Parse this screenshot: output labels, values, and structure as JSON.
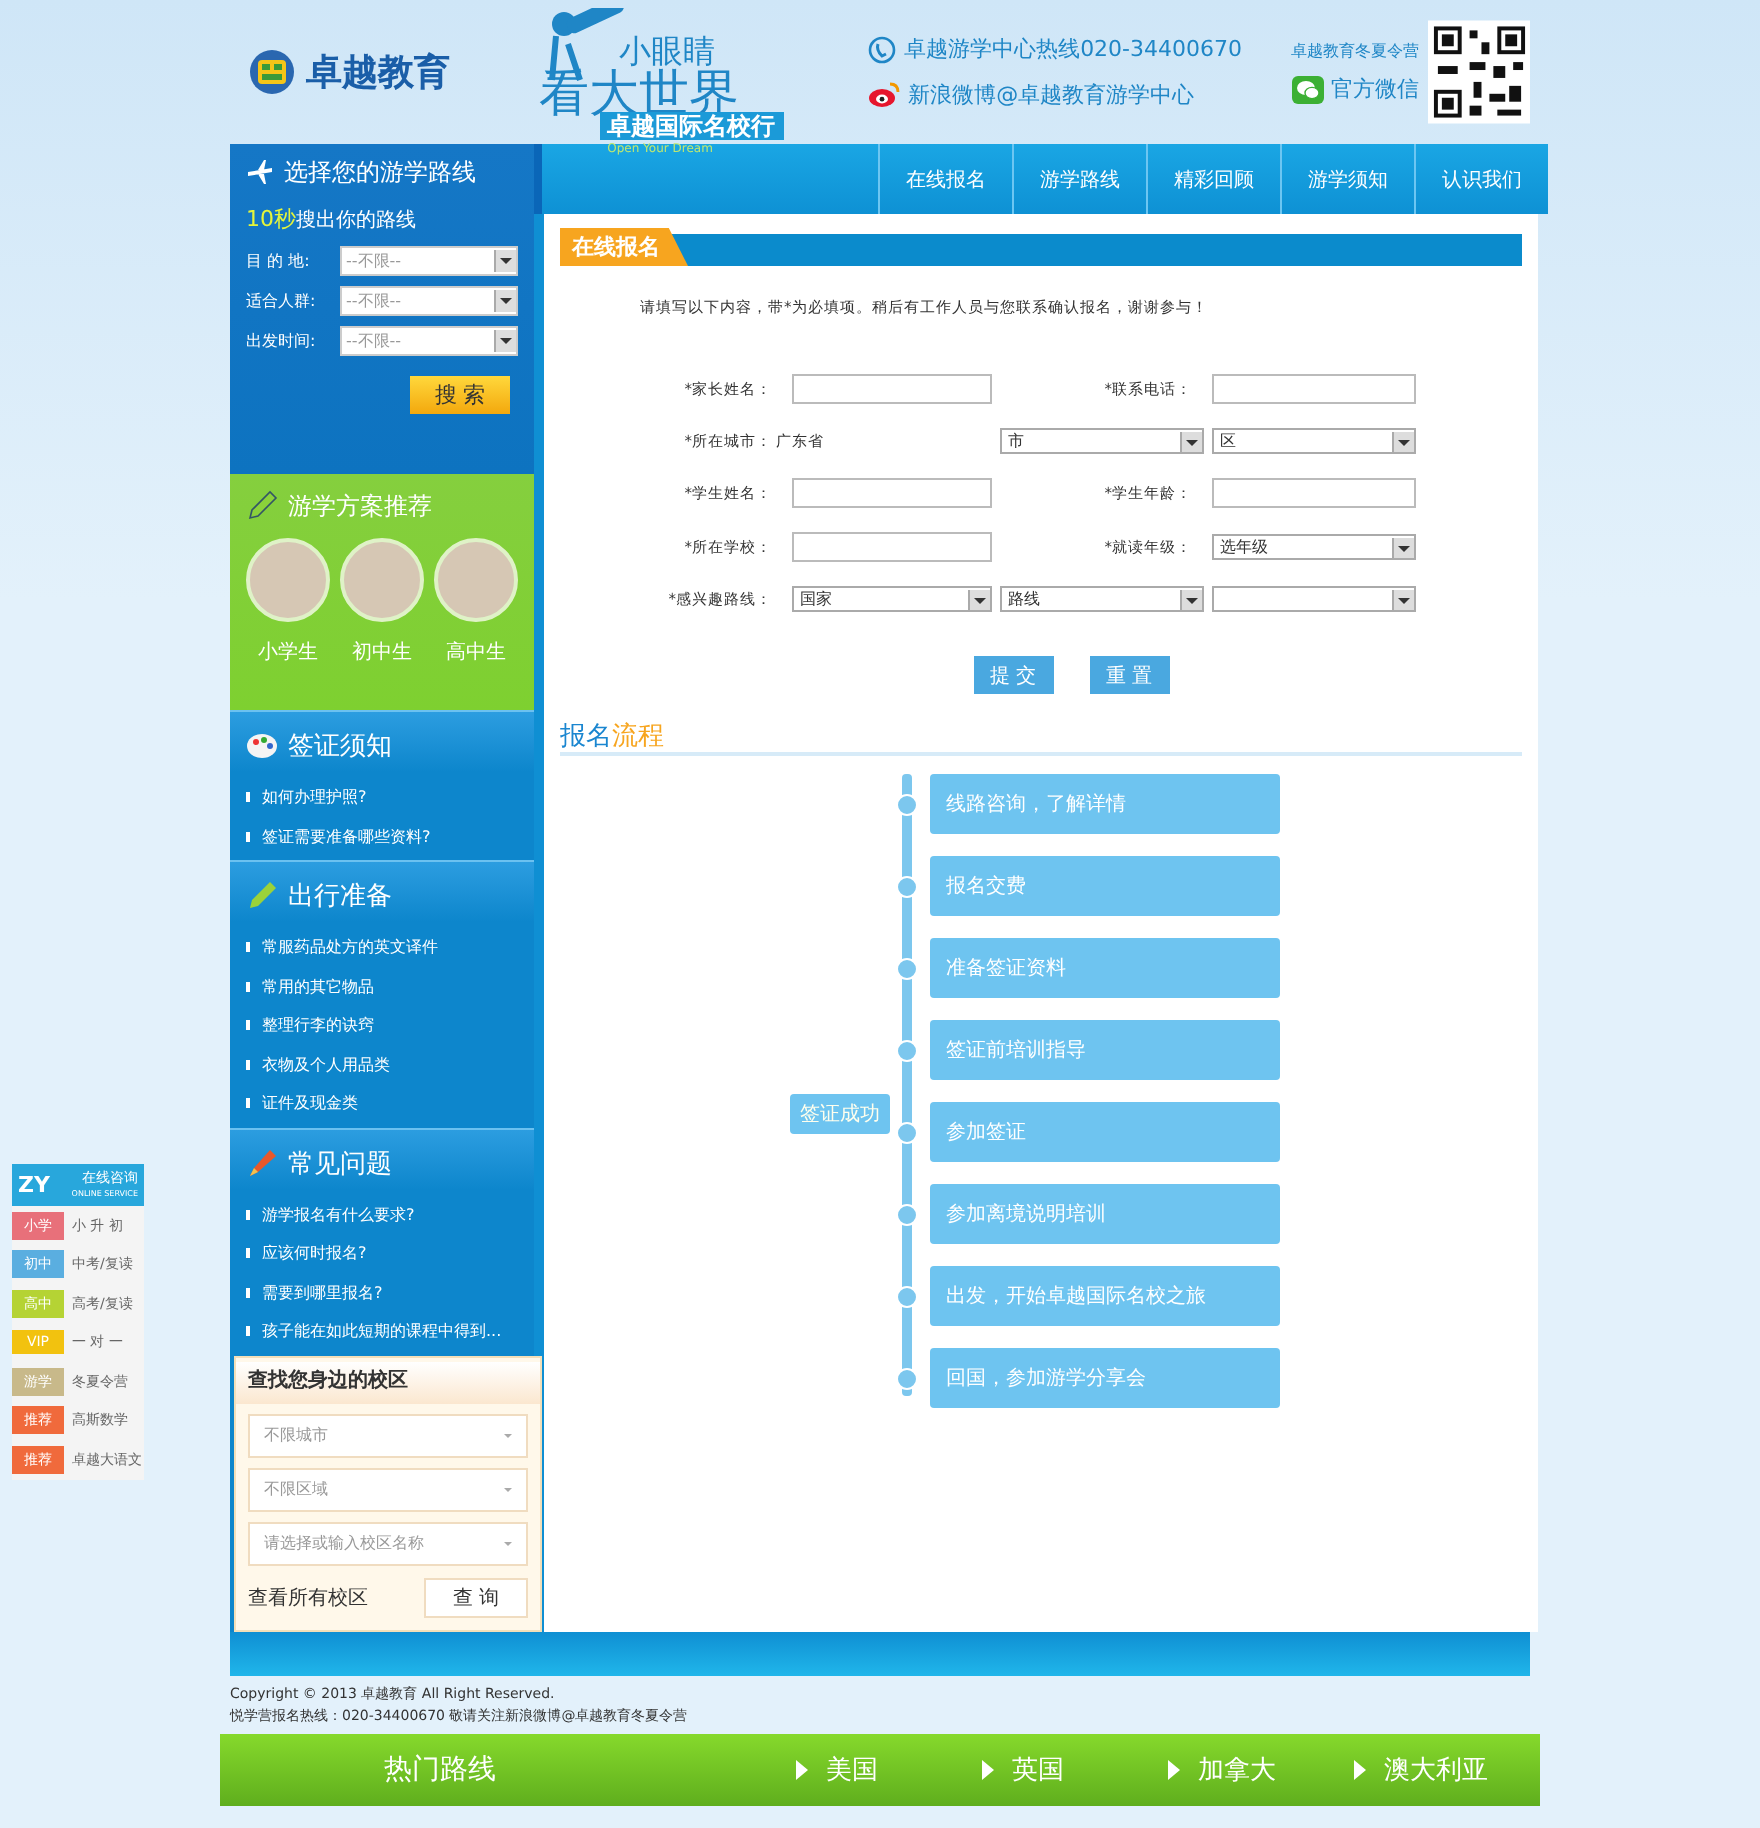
{
  "header": {
    "logo_text": "卓越教育",
    "slogan": {
      "small": "小眼睛",
      "big": "看大世界",
      "sub": "卓越国际名校行",
      "en": "Open Your Dream"
    },
    "hotline": "卓越游学中心热线020-34400670",
    "weibo": "新浪微博@卓越教育游学中心",
    "qr_caption": "卓越教育冬夏令营",
    "wechat": "官方微信"
  },
  "nav": [
    {
      "label": "在线报名"
    },
    {
      "label": "游学路线"
    },
    {
      "label": "精彩回顾"
    },
    {
      "label": "游学须知"
    },
    {
      "label": "认识我们"
    }
  ],
  "route_search": {
    "title": "选择您的游学路线",
    "highlight": "10秒",
    "subtitle": "搜出你的路线",
    "fields": [
      {
        "label": "目 的 地:",
        "value": "--不限--"
      },
      {
        "label": "适合人群:",
        "value": "--不限--"
      },
      {
        "label": "出发时间:",
        "value": "--不限--"
      }
    ],
    "button": "搜 索"
  },
  "recommend": {
    "title": "游学方案推荐",
    "items": [
      {
        "label": "小学生"
      },
      {
        "label": "初中生"
      },
      {
        "label": "高中生"
      }
    ]
  },
  "sections": [
    {
      "kind": "visa",
      "title": "签证须知",
      "links": [
        "如何办理护照?",
        "签证需要准备哪些资料?"
      ]
    },
    {
      "kind": "prep",
      "title": "出行准备",
      "links": [
        "常服药品处方的英文译件",
        "常用的其它物品",
        "整理行李的诀窍",
        "衣物及个人用品类",
        "证件及现金类"
      ]
    },
    {
      "kind": "faq",
      "title": "常见问题",
      "links": [
        "游学报名有什么要求?",
        "应该何时报名?",
        "需要到哪里报名?",
        "孩子能在如此短期的课程中得到..."
      ]
    }
  ],
  "campus_finder": {
    "title": "查找您身边的校区",
    "selects": [
      {
        "placeholder": "不限城市"
      },
      {
        "placeholder": "不限区域"
      },
      {
        "placeholder": "请选择或输入校区名称"
      }
    ],
    "link": "查看所有校区",
    "button": "查 询"
  },
  "online_service": {
    "logo": "ZY",
    "title": "在线咨询",
    "subtitle": "ONLINE SERVICE",
    "items": [
      {
        "tag": "小学",
        "text": "小 升 初",
        "color": "#e8707a"
      },
      {
        "tag": "初中",
        "text": "中考/复读",
        "color": "#5aaee0"
      },
      {
        "tag": "高中",
        "text": "高考/复读",
        "color": "#b5d334"
      },
      {
        "tag": "VIP",
        "text": "一 对 一",
        "color": "#f2c20f"
      },
      {
        "tag": "游学",
        "text": "冬夏令营",
        "color": "#c8b98a"
      },
      {
        "tag": "推荐",
        "text": "高斯数学",
        "color": "#f06a3c"
      },
      {
        "tag": "推荐",
        "text": "卓越大语文",
        "color": "#f06a3c"
      }
    ]
  },
  "form": {
    "title": "在线报名",
    "intro": "请填写以下内容，带*为必填项。稍后有工作人员与您联系确认报名，谢谢参与！",
    "rows": [
      [
        {
          "kind": "label",
          "text": "*家长姓名："
        },
        {
          "kind": "input"
        },
        {
          "kind": "label",
          "text": "*联系电话："
        },
        {
          "kind": "input"
        }
      ],
      [
        {
          "kind": "label",
          "text": "*所在城市："
        },
        {
          "kind": "static",
          "text": "广东省"
        },
        {
          "kind": "select",
          "text": "市"
        },
        {
          "kind": "select",
          "text": "区"
        }
      ],
      [
        {
          "kind": "label",
          "text": "*学生姓名："
        },
        {
          "kind": "input"
        },
        {
          "kind": "label",
          "text": "*学生年龄："
        },
        {
          "kind": "input"
        }
      ],
      [
        {
          "kind": "label",
          "text": "*所在学校："
        },
        {
          "kind": "input"
        },
        {
          "kind": "label",
          "text": "*就读年级："
        },
        {
          "kind": "select",
          "text": "选年级"
        }
      ],
      [
        {
          "kind": "label",
          "text": "*感兴趣路线："
        },
        {
          "kind": "select",
          "text": "国家"
        },
        {
          "kind": "select",
          "text": "路线"
        },
        {
          "kind": "select"
        }
      ]
    ],
    "buttons": [
      "提 交",
      "重 置"
    ]
  },
  "process": {
    "title_main": "报名",
    "title_accent": "流程",
    "steps": [
      "线路咨询，了解详情",
      "报名交费",
      "准备签证资料",
      "签证前培训指导",
      "参加签证",
      "参加离境说明培训",
      "出发，开始卓越国际名校之旅",
      "回国，参加游学分享会"
    ],
    "result": "签证成功"
  },
  "footer": {
    "copyright": "Copyright © 2013 卓越教育 All Right Reserved.",
    "contact": "悦学营报名热线：020-34400670 敬请关注新浪微博@卓越教育冬夏令营"
  },
  "hot_routes": {
    "title": "热门路线",
    "items": [
      "美国",
      "英国",
      "加拿大",
      "澳大利亚"
    ]
  }
}
